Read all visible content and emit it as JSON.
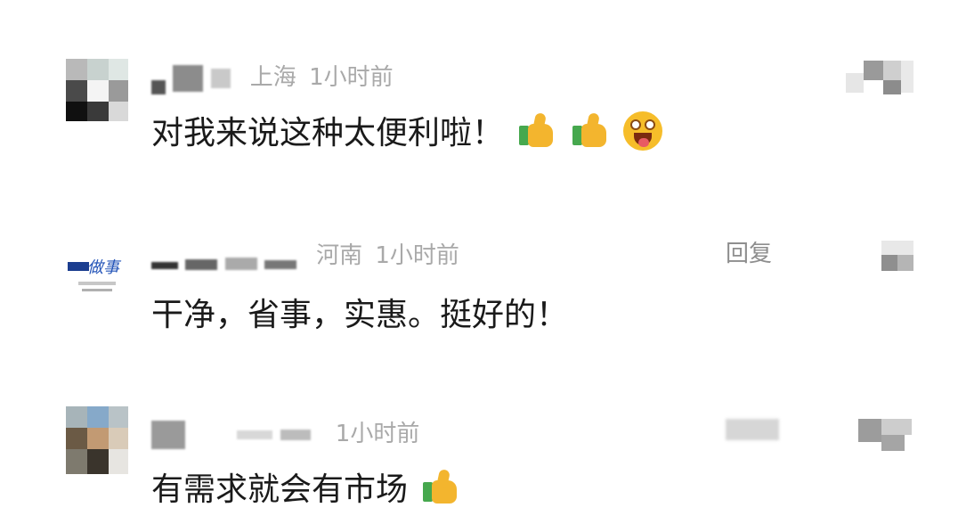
{
  "comments": [
    {
      "location": "上海",
      "time": "1小时前",
      "reply_label": "",
      "text": "对我来说这种太便利啦！",
      "emojis": [
        "thumbs-up-icon",
        "thumbs-up-icon",
        "grinning-tongue-face-icon"
      ]
    },
    {
      "location": "河南",
      "time": "1小时前",
      "reply_label": "回复",
      "avatar_text": "做事",
      "text": "干净，省事，实惠。挺好的！",
      "emojis": []
    },
    {
      "location": "",
      "time": "1小时前",
      "reply_label": "",
      "text": "有需求就会有市场",
      "emojis": [
        "thumbs-up-icon"
      ]
    }
  ],
  "colors": {
    "background": "#ffffff",
    "comment_text": "#1a1a1a",
    "meta_text": "#a9a9a9",
    "reply_text": "#8e8e8e"
  }
}
